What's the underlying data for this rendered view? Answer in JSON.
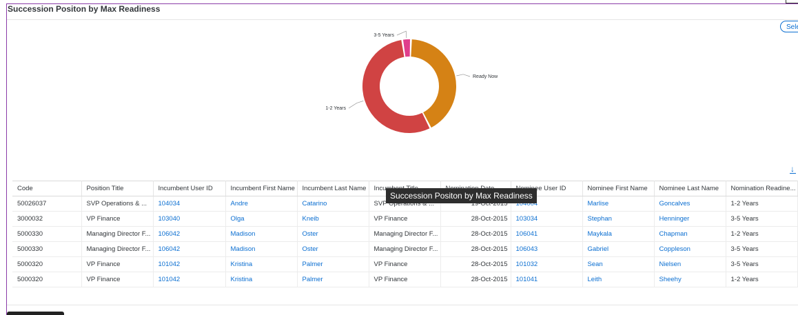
{
  "panel": {
    "title": "Succession Positon by Max Readiness",
    "select_label": "Selec",
    "tooltip": "Succession Positon by Max Readiness"
  },
  "chart_data": {
    "type": "pie",
    "categories": [
      "Ready Now",
      "1-2 Years",
      "3-5 Years"
    ],
    "values": [
      42,
      55,
      3
    ],
    "colors": [
      "#d58215",
      "#d04343",
      "#e03e8c"
    ],
    "style": "donut"
  },
  "table": {
    "headers": [
      "Code",
      "Position Title",
      "Incumbent User ID",
      "Incumbent First Name",
      "Incumbent Last Name",
      "Incumbent Title",
      "Nomination Date",
      "Nominee User ID",
      "Nominee First Name",
      "Nominee Last Name",
      "Nomination Readine..."
    ],
    "rows": [
      [
        "50026037",
        "SVP Operations & ...",
        "104034",
        "Andre",
        "Catarino",
        "SVP Operations & ...",
        "19-Oct-2015",
        "104004",
        "Marlise",
        "Goncalves",
        "1-2 Years"
      ],
      [
        "3000032",
        "VP Finance",
        "103040",
        "Olga",
        "Kneib",
        "VP Finance",
        "28-Oct-2015",
        "103034",
        "Stephan",
        "Henninger",
        "3-5 Years"
      ],
      [
        "5000330",
        "Managing Director F...",
        "106042",
        "Madison",
        "Oster",
        "Managing Director F...",
        "28-Oct-2015",
        "106041",
        "Maykala",
        "Chapman",
        "1-2 Years"
      ],
      [
        "5000330",
        "Managing Director F...",
        "106042",
        "Madison",
        "Oster",
        "Managing Director F...",
        "28-Oct-2015",
        "106043",
        "Gabriel",
        "Coppleson",
        "3-5 Years"
      ],
      [
        "5000320",
        "VP Finance",
        "101042",
        "Kristina",
        "Palmer",
        "VP Finance",
        "28-Oct-2015",
        "101032",
        "Sean",
        "Nielsen",
        "3-5 Years"
      ],
      [
        "5000320",
        "VP Finance",
        "101042",
        "Kristina",
        "Palmer",
        "VP Finance",
        "28-Oct-2015",
        "101041",
        "Leith",
        "Sheehy",
        "1-2 Years"
      ]
    ]
  },
  "icons": {
    "download": "download-icon"
  }
}
